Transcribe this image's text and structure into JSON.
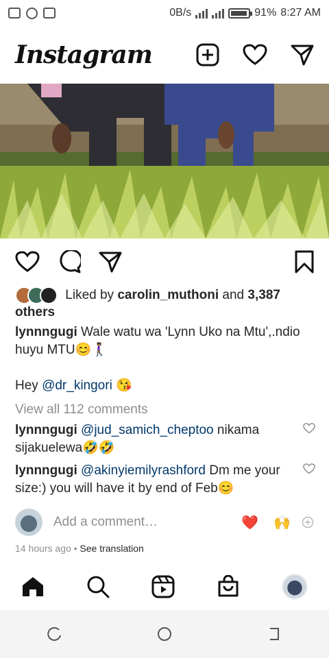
{
  "status_bar": {
    "speed": "0B/s",
    "battery": "91%",
    "time": "8:27 AM"
  },
  "header": {
    "logo": "Instagram"
  },
  "post": {
    "liked_by_prefix": "Liked by",
    "liked_by_user": "carolin_muthoni",
    "liked_by_and": "and",
    "liked_by_others": "3,387 others",
    "caption_user": "lynnngugi",
    "caption_text": "Wale watu wa 'Lynn Uko na Mtu',.ndio huyu MTU😊🚶🏾‍♀️",
    "caption_hey": "Hey",
    "caption_mention": "@dr_kingori",
    "caption_emoji": "😘",
    "view_comments": "View all 112 comments",
    "comments": [
      {
        "user": "lynnngugi",
        "mention": "@jud_samich_cheptoo",
        "text": "nikama sijakuelewa🤣🤣"
      },
      {
        "user": "lynnngugi",
        "mention": "@akinyiemilyrashford",
        "text": "Dm me your size:) you will have it by end of Feb😊"
      }
    ],
    "add_comment_placeholder": "Add a comment…",
    "quick_reactions": [
      "❤️",
      "🙌"
    ],
    "time_ago": "14 hours ago",
    "separator": "•",
    "see_translation": "See translation"
  },
  "colors": {
    "mention": "#00376b",
    "muted": "#8e8e8e",
    "text": "#262626"
  }
}
